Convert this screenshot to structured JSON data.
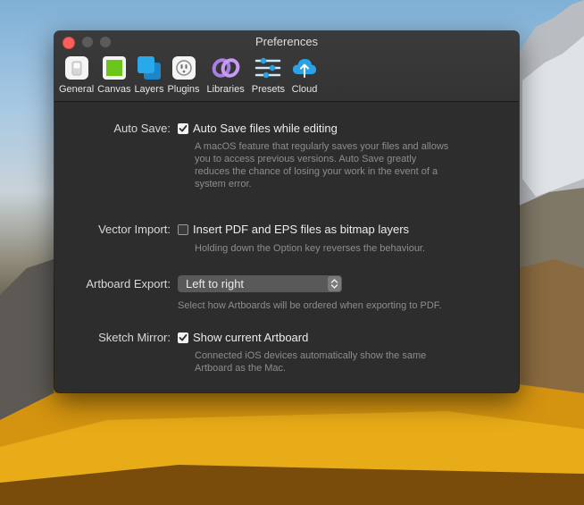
{
  "window": {
    "title": "Preferences"
  },
  "toolbar": {
    "items": [
      {
        "label": "General",
        "icon": "general-switch-icon"
      },
      {
        "label": "Canvas",
        "icon": "canvas-icon"
      },
      {
        "label": "Layers",
        "icon": "layers-icon"
      },
      {
        "label": "Plugins",
        "icon": "plugins-icon"
      },
      {
        "label": "Libraries",
        "icon": "libraries-icon"
      },
      {
        "label": "Presets",
        "icon": "presets-icon"
      },
      {
        "label": "Cloud",
        "icon": "cloud-icon"
      }
    ]
  },
  "settings": {
    "auto_save": {
      "label": "Auto Save:",
      "checkbox_label": "Auto Save files while editing",
      "checked": true,
      "description": "A macOS feature that regularly saves your files and allows you to access previous versions. Auto Save greatly reduces the chance of losing your work in the event of a system error."
    },
    "vector_import": {
      "label": "Vector Import:",
      "checkbox_label": "Insert PDF and EPS files as bitmap layers",
      "checked": false,
      "description": "Holding down the Option key reverses the behaviour."
    },
    "artboard_export": {
      "label": "Artboard Export:",
      "selected": "Left to right",
      "description": "Select how Artboards will be ordered when exporting to PDF."
    },
    "sketch_mirror": {
      "label": "Sketch Mirror:",
      "checkbox_label": "Show current Artboard",
      "checked": true,
      "description": "Connected iOS devices automatically show the same Artboard as the Mac."
    }
  },
  "colors": {
    "window_bg": "#2d2d2d",
    "titlebar_bg": "#363636",
    "close_button": "#fc605c",
    "canvas_green": "#6bc51a",
    "layers_blue": "#29a8ea",
    "libraries_purple": "#a97ee6",
    "cloud_blue": "#2aa3e6"
  }
}
